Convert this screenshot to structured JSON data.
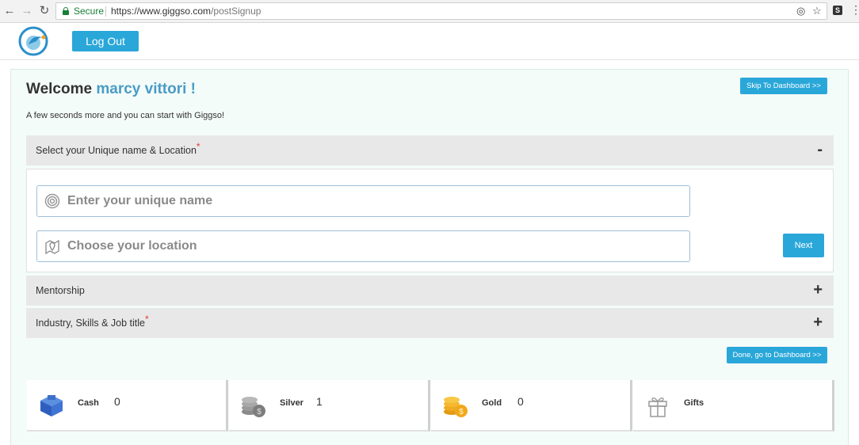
{
  "browser": {
    "secure_label": "Secure",
    "url_host": "https://www.giggso.com",
    "url_path": "/postSignup"
  },
  "header": {
    "logout_label": "Log Out"
  },
  "welcome": {
    "greeting": "Welcome",
    "user_name": "marcy vittori !",
    "subtitle": "A few seconds more and you can start with Giggso!",
    "skip_label": "Skip To Dashboard >>"
  },
  "sections": [
    {
      "title": "Select your Unique name & Location",
      "required_mark": "*",
      "toggle": "-"
    },
    {
      "title": "Mentorship",
      "required_mark": "",
      "toggle": "+"
    },
    {
      "title": "Industry, Skills & Job title",
      "required_mark": "*",
      "toggle": "+"
    }
  ],
  "form": {
    "name_placeholder": "Enter your unique name",
    "location_placeholder": "Choose your location",
    "next_label": "Next"
  },
  "done_label": "Done, go to Dashboard >>",
  "wallet": [
    {
      "label": "Cash",
      "value": "0",
      "icon": "cash-cube-icon"
    },
    {
      "label": "Silver",
      "value": "1",
      "icon": "silver-coins-icon"
    },
    {
      "label": "Gold",
      "value": "0",
      "icon": "gold-coins-icon"
    },
    {
      "label": "Gifts",
      "value": "",
      "icon": "gift-icon"
    }
  ],
  "colors": {
    "accent": "#2aa7d9",
    "name_color": "#4a9cc6",
    "panel_bg": "#f4fcf9",
    "required": "#e53935"
  }
}
